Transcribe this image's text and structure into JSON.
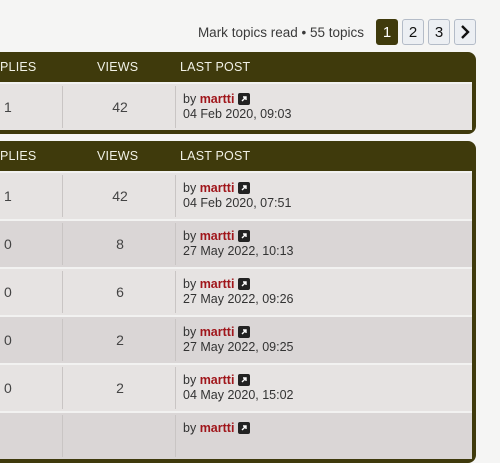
{
  "topbar": {
    "mark_read": "Mark topics read • 55 topics",
    "pages": [
      "1",
      "2",
      "3"
    ],
    "active_page": "1"
  },
  "headers": {
    "replies": "PLIES",
    "views": "VIEWS",
    "last_post": "LAST POST"
  },
  "block1": {
    "rows": [
      {
        "replies": "1",
        "views": "42",
        "by": "by",
        "author": "martti",
        "date": "04 Feb 2020, 09:03"
      }
    ]
  },
  "block2": {
    "rows": [
      {
        "replies": "1",
        "views": "42",
        "by": "by",
        "author": "martti",
        "date": "04 Feb 2020, 07:51"
      },
      {
        "replies": "0",
        "views": "8",
        "by": "by",
        "author": "martti",
        "date": "27 May 2022, 10:13"
      },
      {
        "replies": "0",
        "views": "6",
        "by": "by",
        "author": "martti",
        "date": "27 May 2022, 09:26"
      },
      {
        "replies": "0",
        "views": "2",
        "by": "by",
        "author": "martti",
        "date": "27 May 2022, 09:25"
      },
      {
        "replies": "0",
        "views": "2",
        "by": "by",
        "author": "martti",
        "date": "04 May 2020, 15:02"
      },
      {
        "replies": "",
        "views": "",
        "by": "by",
        "author": "martti",
        "date": ""
      }
    ]
  },
  "colors": {
    "header_bg": "#3f3a0c",
    "author": "#a0161b",
    "row_light": "#e6e3e2",
    "row_dark": "#dad6d6"
  },
  "icons": {
    "goto": "external-link-icon",
    "next": "chevron-right-icon"
  }
}
